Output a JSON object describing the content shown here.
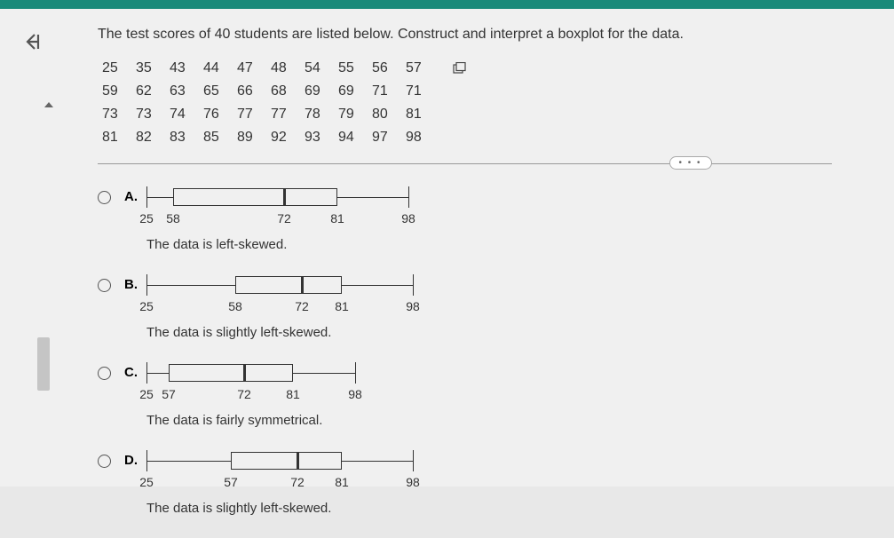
{
  "question": "The test scores of 40 students are listed below. Construct and interpret a boxplot for the data.",
  "data_rows": [
    [
      "25",
      "35",
      "43",
      "44",
      "47",
      "48",
      "54",
      "55",
      "56",
      "57"
    ],
    [
      "59",
      "62",
      "63",
      "65",
      "66",
      "68",
      "69",
      "69",
      "71",
      "71"
    ],
    [
      "73",
      "73",
      "74",
      "76",
      "77",
      "77",
      "78",
      "79",
      "80",
      "81"
    ],
    [
      "81",
      "82",
      "83",
      "85",
      "89",
      "92",
      "93",
      "94",
      "97",
      "98"
    ]
  ],
  "dots": "• • •",
  "options": {
    "A": {
      "label": "A.",
      "ticks": [
        "25",
        "58",
        "72",
        "81",
        "98"
      ],
      "interp": "The data is left-skewed."
    },
    "B": {
      "label": "B.",
      "ticks": [
        "25",
        "58",
        "72",
        "81",
        "98"
      ],
      "interp": "The data is slightly left-skewed."
    },
    "C": {
      "label": "C.",
      "ticks": [
        "25",
        "57",
        "72",
        "81",
        "98"
      ],
      "interp": "The data is fairly symmetrical."
    },
    "D": {
      "label": "D.",
      "ticks": [
        "25",
        "57",
        "72",
        "81",
        "98"
      ],
      "interp": "The data is slightly left-skewed."
    }
  },
  "chart_data": [
    {
      "type": "boxplot",
      "option": "A",
      "min": 25,
      "q1": 58,
      "median": 72,
      "q3": 81,
      "max": 98,
      "whisker_starts_at_min": true
    },
    {
      "type": "boxplot",
      "option": "B",
      "min": 25,
      "q1": 58,
      "median": 72,
      "q3": 81,
      "max": 98,
      "whisker_starts_at_min": false
    },
    {
      "type": "boxplot",
      "option": "C",
      "min": 25,
      "q1": 57,
      "median": 72,
      "q3": 81,
      "max": 98,
      "whisker_starts_at_min": true
    },
    {
      "type": "boxplot",
      "option": "D",
      "min": 25,
      "q1": 57,
      "median": 72,
      "q3": 81,
      "max": 98,
      "whisker_starts_at_min": false
    }
  ]
}
